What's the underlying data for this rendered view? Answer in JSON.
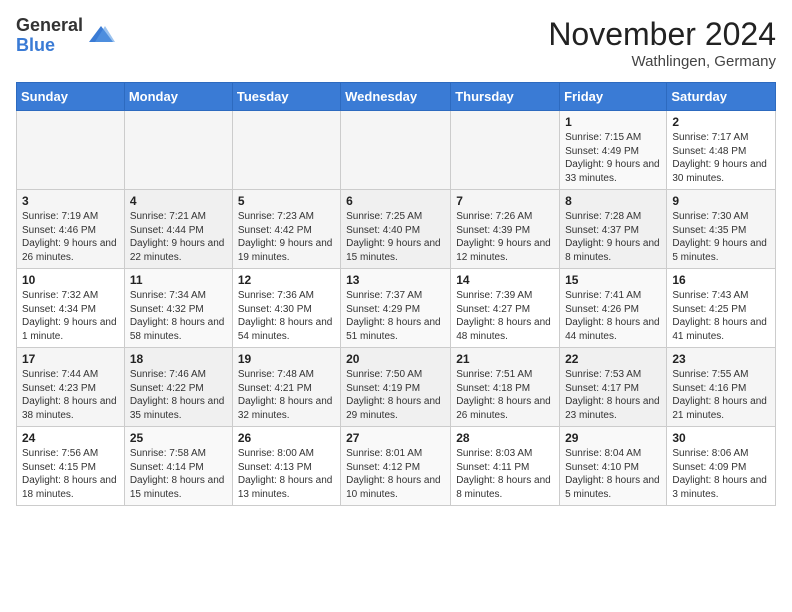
{
  "logo": {
    "general": "General",
    "blue": "Blue"
  },
  "title": "November 2024",
  "location": "Wathlingen, Germany",
  "headers": [
    "Sunday",
    "Monday",
    "Tuesday",
    "Wednesday",
    "Thursday",
    "Friday",
    "Saturday"
  ],
  "weeks": [
    [
      {
        "day": "",
        "info": ""
      },
      {
        "day": "",
        "info": ""
      },
      {
        "day": "",
        "info": ""
      },
      {
        "day": "",
        "info": ""
      },
      {
        "day": "",
        "info": ""
      },
      {
        "day": "1",
        "info": "Sunrise: 7:15 AM\nSunset: 4:49 PM\nDaylight: 9 hours and 33 minutes."
      },
      {
        "day": "2",
        "info": "Sunrise: 7:17 AM\nSunset: 4:48 PM\nDaylight: 9 hours and 30 minutes."
      }
    ],
    [
      {
        "day": "3",
        "info": "Sunrise: 7:19 AM\nSunset: 4:46 PM\nDaylight: 9 hours and 26 minutes."
      },
      {
        "day": "4",
        "info": "Sunrise: 7:21 AM\nSunset: 4:44 PM\nDaylight: 9 hours and 22 minutes."
      },
      {
        "day": "5",
        "info": "Sunrise: 7:23 AM\nSunset: 4:42 PM\nDaylight: 9 hours and 19 minutes."
      },
      {
        "day": "6",
        "info": "Sunrise: 7:25 AM\nSunset: 4:40 PM\nDaylight: 9 hours and 15 minutes."
      },
      {
        "day": "7",
        "info": "Sunrise: 7:26 AM\nSunset: 4:39 PM\nDaylight: 9 hours and 12 minutes."
      },
      {
        "day": "8",
        "info": "Sunrise: 7:28 AM\nSunset: 4:37 PM\nDaylight: 9 hours and 8 minutes."
      },
      {
        "day": "9",
        "info": "Sunrise: 7:30 AM\nSunset: 4:35 PM\nDaylight: 9 hours and 5 minutes."
      }
    ],
    [
      {
        "day": "10",
        "info": "Sunrise: 7:32 AM\nSunset: 4:34 PM\nDaylight: 9 hours and 1 minute."
      },
      {
        "day": "11",
        "info": "Sunrise: 7:34 AM\nSunset: 4:32 PM\nDaylight: 8 hours and 58 minutes."
      },
      {
        "day": "12",
        "info": "Sunrise: 7:36 AM\nSunset: 4:30 PM\nDaylight: 8 hours and 54 minutes."
      },
      {
        "day": "13",
        "info": "Sunrise: 7:37 AM\nSunset: 4:29 PM\nDaylight: 8 hours and 51 minutes."
      },
      {
        "day": "14",
        "info": "Sunrise: 7:39 AM\nSunset: 4:27 PM\nDaylight: 8 hours and 48 minutes."
      },
      {
        "day": "15",
        "info": "Sunrise: 7:41 AM\nSunset: 4:26 PM\nDaylight: 8 hours and 44 minutes."
      },
      {
        "day": "16",
        "info": "Sunrise: 7:43 AM\nSunset: 4:25 PM\nDaylight: 8 hours and 41 minutes."
      }
    ],
    [
      {
        "day": "17",
        "info": "Sunrise: 7:44 AM\nSunset: 4:23 PM\nDaylight: 8 hours and 38 minutes."
      },
      {
        "day": "18",
        "info": "Sunrise: 7:46 AM\nSunset: 4:22 PM\nDaylight: 8 hours and 35 minutes."
      },
      {
        "day": "19",
        "info": "Sunrise: 7:48 AM\nSunset: 4:21 PM\nDaylight: 8 hours and 32 minutes."
      },
      {
        "day": "20",
        "info": "Sunrise: 7:50 AM\nSunset: 4:19 PM\nDaylight: 8 hours and 29 minutes."
      },
      {
        "day": "21",
        "info": "Sunrise: 7:51 AM\nSunset: 4:18 PM\nDaylight: 8 hours and 26 minutes."
      },
      {
        "day": "22",
        "info": "Sunrise: 7:53 AM\nSunset: 4:17 PM\nDaylight: 8 hours and 23 minutes."
      },
      {
        "day": "23",
        "info": "Sunrise: 7:55 AM\nSunset: 4:16 PM\nDaylight: 8 hours and 21 minutes."
      }
    ],
    [
      {
        "day": "24",
        "info": "Sunrise: 7:56 AM\nSunset: 4:15 PM\nDaylight: 8 hours and 18 minutes."
      },
      {
        "day": "25",
        "info": "Sunrise: 7:58 AM\nSunset: 4:14 PM\nDaylight: 8 hours and 15 minutes."
      },
      {
        "day": "26",
        "info": "Sunrise: 8:00 AM\nSunset: 4:13 PM\nDaylight: 8 hours and 13 minutes."
      },
      {
        "day": "27",
        "info": "Sunrise: 8:01 AM\nSunset: 4:12 PM\nDaylight: 8 hours and 10 minutes."
      },
      {
        "day": "28",
        "info": "Sunrise: 8:03 AM\nSunset: 4:11 PM\nDaylight: 8 hours and 8 minutes."
      },
      {
        "day": "29",
        "info": "Sunrise: 8:04 AM\nSunset: 4:10 PM\nDaylight: 8 hours and 5 minutes."
      },
      {
        "day": "30",
        "info": "Sunrise: 8:06 AM\nSunset: 4:09 PM\nDaylight: 8 hours and 3 minutes."
      }
    ]
  ]
}
